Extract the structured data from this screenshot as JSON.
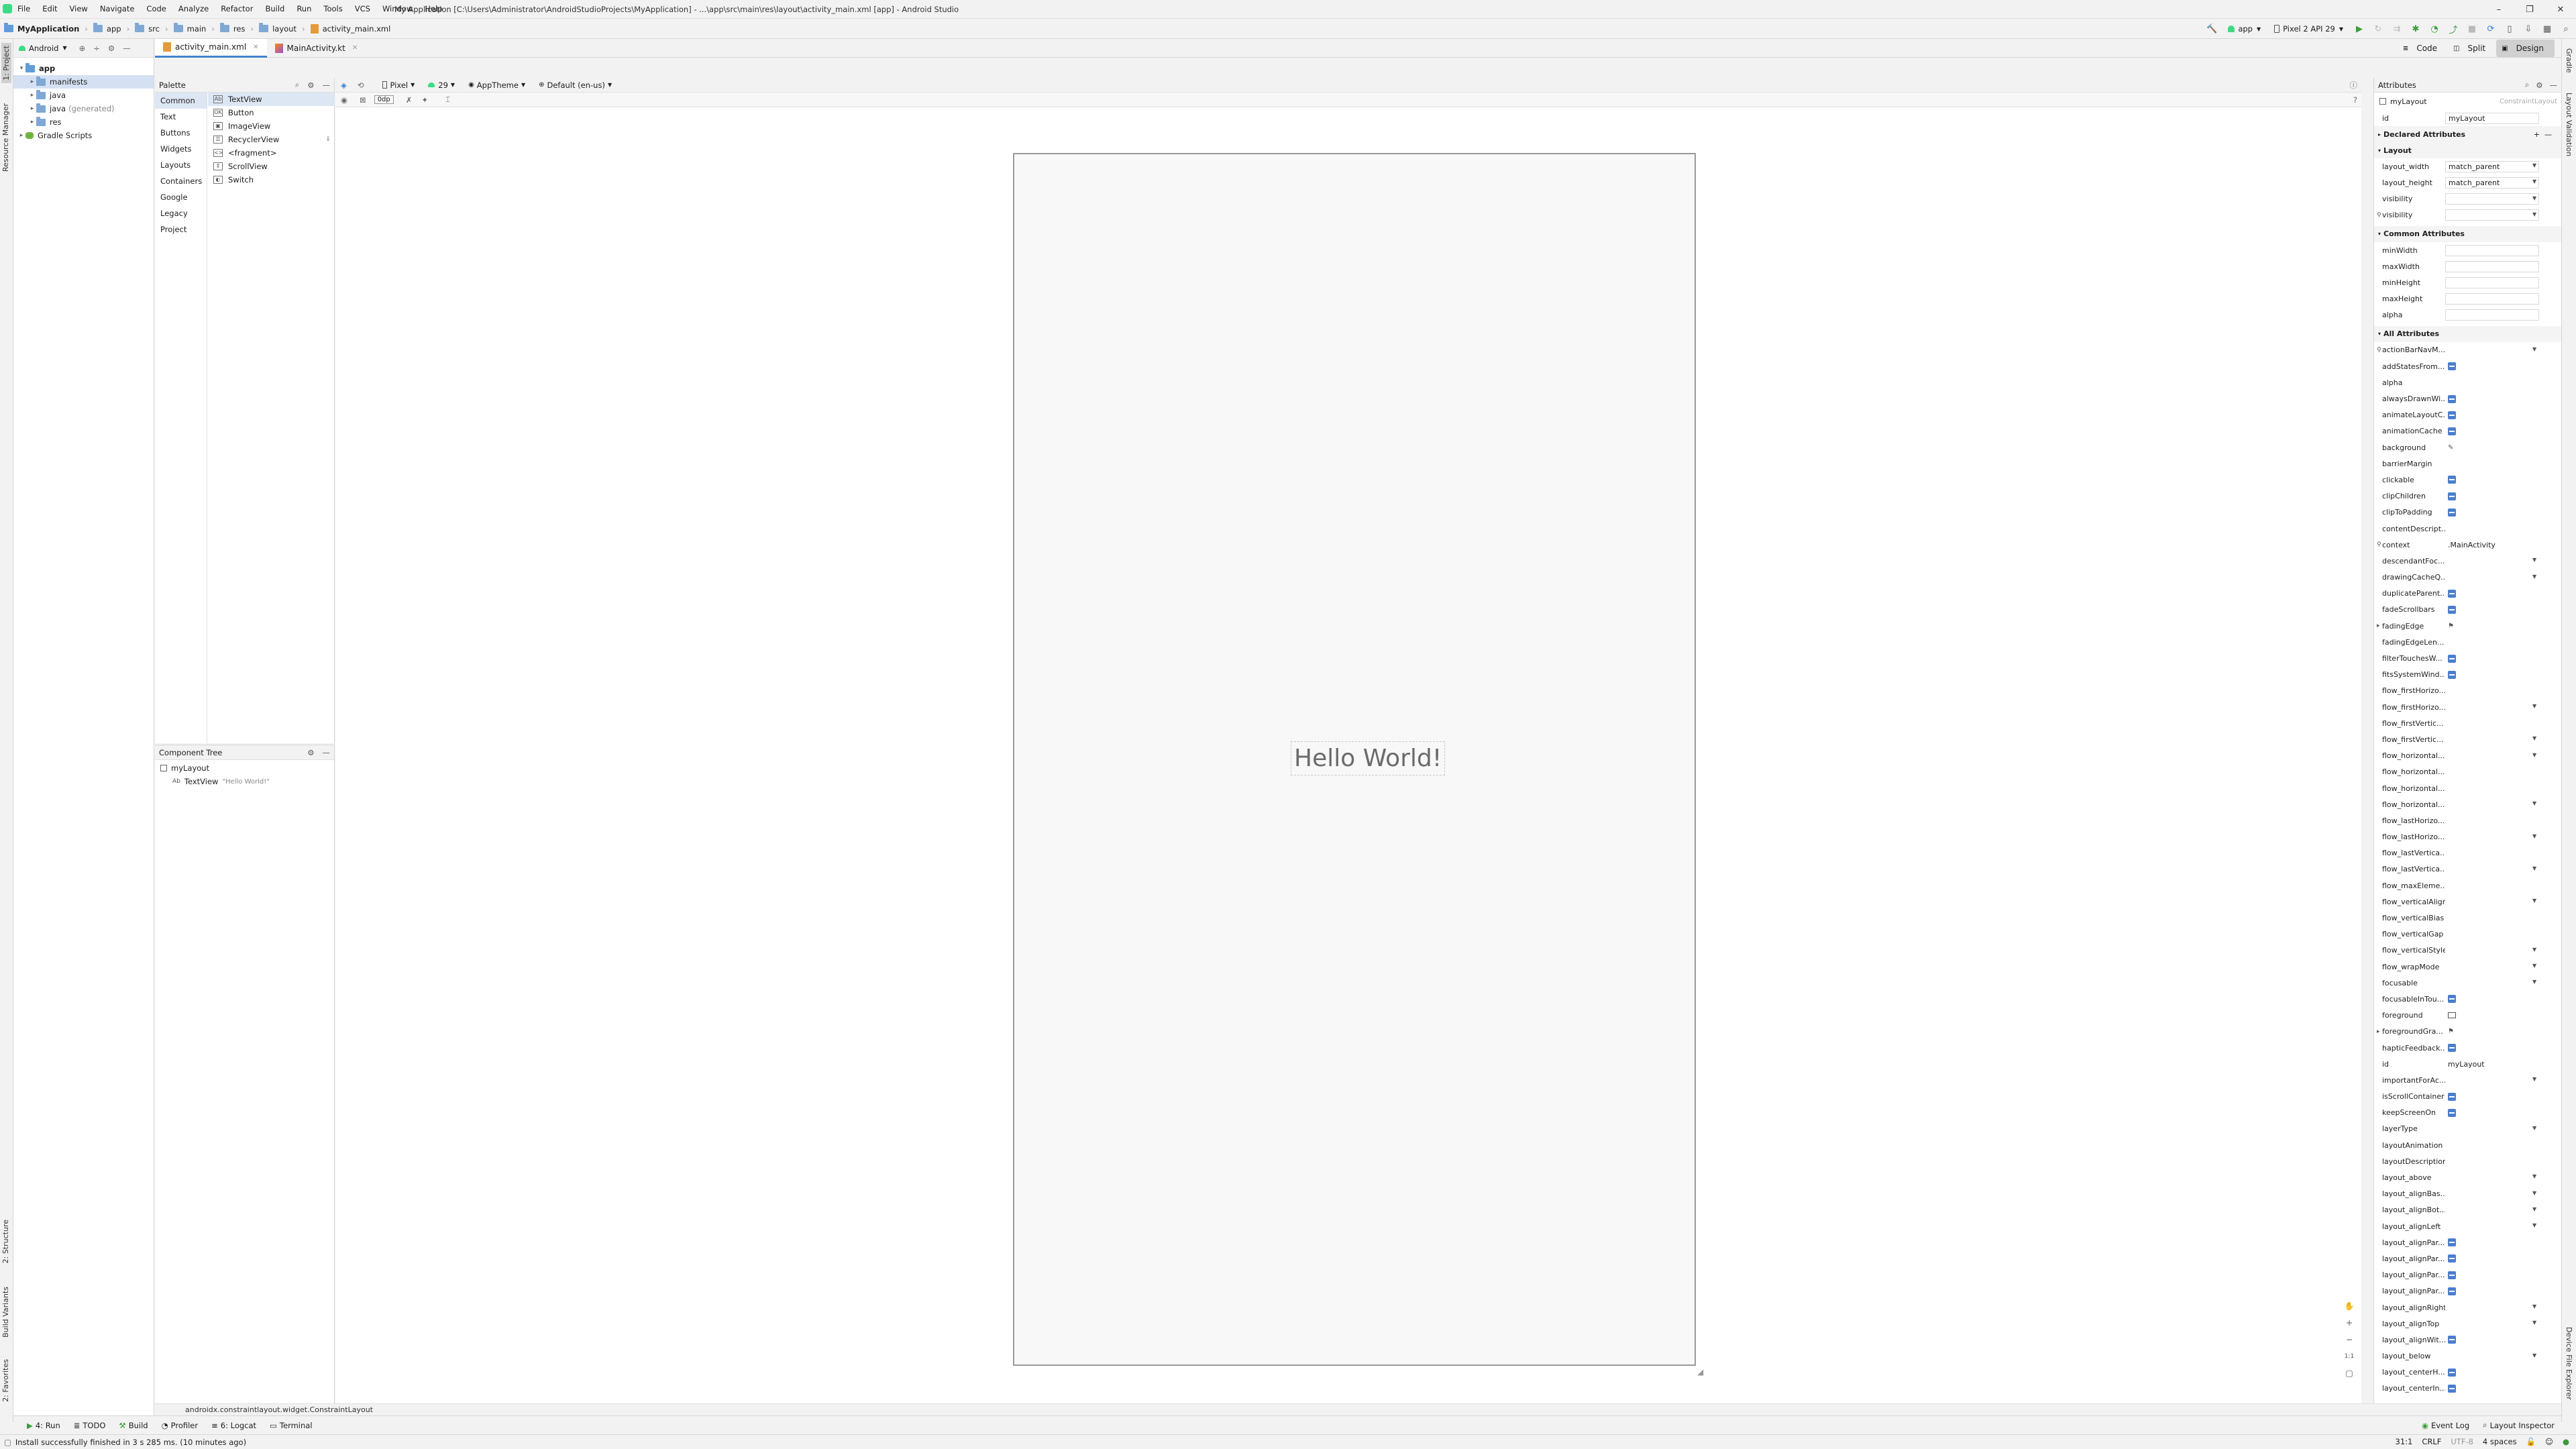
{
  "menu": [
    "File",
    "Edit",
    "View",
    "Navigate",
    "Code",
    "Analyze",
    "Refactor",
    "Build",
    "Run",
    "Tools",
    "VCS",
    "Window",
    "Help"
  ],
  "window_title": "My Application [C:\\Users\\Administrator\\AndroidStudioProjects\\MyApplication] - ...\\app\\src\\main\\res\\layout\\activity_main.xml [app] - Android Studio",
  "breadcrumbs": [
    "MyApplication",
    "app",
    "src",
    "main",
    "res",
    "layout",
    "activity_main.xml"
  ],
  "toolbar": {
    "run_config": "app",
    "device": "Pixel 2 API 29"
  },
  "project": {
    "view_mode": "Android",
    "tree": [
      {
        "label": "app",
        "depth": 0,
        "expanded": true
      },
      {
        "label": "manifests",
        "depth": 1,
        "selected": true
      },
      {
        "label": "java",
        "depth": 1
      },
      {
        "label": "java",
        "suffix": "(generated)",
        "depth": 1
      },
      {
        "label": "res",
        "depth": 1
      },
      {
        "label": "Gradle Scripts",
        "depth": 0
      }
    ]
  },
  "left_tabs": [
    "1: Project",
    "Resource Manager",
    "2: Structure",
    "Build Variants",
    "2: Favorites"
  ],
  "right_tabs": [
    "Gradle",
    "Layout Validation",
    "Device File Explorer"
  ],
  "editor_tabs": [
    {
      "label": "activity_main.xml",
      "active": true
    },
    {
      "label": "MainActivity.kt",
      "active": false
    }
  ],
  "view_modes": [
    "Code",
    "Split",
    "Design"
  ],
  "palette": {
    "title": "Palette",
    "categories": [
      "Common",
      "Text",
      "Buttons",
      "Widgets",
      "Layouts",
      "Containers",
      "Google",
      "Legacy",
      "Project"
    ],
    "items": [
      "TextView",
      "Button",
      "ImageView",
      "RecyclerView",
      "<fragment>",
      "ScrollView",
      "Switch"
    ]
  },
  "component_tree": {
    "title": "Component Tree",
    "root": "myLayout",
    "child": "TextView",
    "child_text": "\"Hello World!\""
  },
  "design_toolbar": {
    "device": "Pixel",
    "api": "29",
    "theme": "AppTheme",
    "locale": "Default (en-us)",
    "margin": "0dp"
  },
  "canvas": {
    "hello_text": "Hello World!"
  },
  "attributes": {
    "title": "Attributes",
    "component_id": "myLayout",
    "component_class": "ConstraintLayout",
    "id_label": "id",
    "id_value": "myLayout",
    "declared": "Declared Attributes",
    "layout_section": "Layout",
    "layout_rows": [
      {
        "name": "layout_width",
        "value": "match_parent",
        "dd": true
      },
      {
        "name": "layout_height",
        "value": "match_parent",
        "dd": true
      },
      {
        "name": "visibility",
        "value": "",
        "dd": true
      },
      {
        "name": "visibility",
        "value": "",
        "dd": true,
        "pin": true
      }
    ],
    "common_section": "Common Attributes",
    "common_rows": [
      "minWidth",
      "maxWidth",
      "minHeight",
      "maxHeight",
      "alpha"
    ],
    "all_section": "All Attributes",
    "all_rows": [
      {
        "name": "actionBarNavM...",
        "t": "dd",
        "pin": true
      },
      {
        "name": "addStatesFrom...",
        "t": "cb"
      },
      {
        "name": "alpha",
        "t": ""
      },
      {
        "name": "alwaysDrawnWi...",
        "t": "cb"
      },
      {
        "name": "animateLayoutC...",
        "t": "cb"
      },
      {
        "name": "animationCache",
        "t": "cb"
      },
      {
        "name": "background",
        "t": "pen"
      },
      {
        "name": "barrierMargin",
        "t": ""
      },
      {
        "name": "clickable",
        "t": "cb"
      },
      {
        "name": "clipChildren",
        "t": "cb"
      },
      {
        "name": "clipToPadding",
        "t": "cb"
      },
      {
        "name": "contentDescript...",
        "t": ""
      },
      {
        "name": "context",
        "t": "text",
        "value": ".MainActivity",
        "pin": true
      },
      {
        "name": "descendantFoc...",
        "t": "dd"
      },
      {
        "name": "drawingCacheQ...",
        "t": "dd"
      },
      {
        "name": "duplicateParent...",
        "t": "cb"
      },
      {
        "name": "fadeScrollbars",
        "t": "cb"
      },
      {
        "name": "fadingEdge",
        "t": "flag",
        "expand": true
      },
      {
        "name": "fadingEdgeLen...",
        "t": ""
      },
      {
        "name": "filterTouchesW...",
        "t": "cb"
      },
      {
        "name": "fitsSystemWind...",
        "t": "cb"
      },
      {
        "name": "flow_firstHorizo...",
        "t": ""
      },
      {
        "name": "flow_firstHorizo...",
        "t": "dd"
      },
      {
        "name": "flow_firstVertic...",
        "t": ""
      },
      {
        "name": "flow_firstVertic...",
        "t": "dd"
      },
      {
        "name": "flow_horizontal...",
        "t": "dd"
      },
      {
        "name": "flow_horizontal...",
        "t": ""
      },
      {
        "name": "flow_horizontal...",
        "t": ""
      },
      {
        "name": "flow_horizontal...",
        "t": "dd"
      },
      {
        "name": "flow_lastHorizo...",
        "t": ""
      },
      {
        "name": "flow_lastHorizo...",
        "t": "dd"
      },
      {
        "name": "flow_lastVertica...",
        "t": ""
      },
      {
        "name": "flow_lastVertica...",
        "t": "dd"
      },
      {
        "name": "flow_maxEleme...",
        "t": ""
      },
      {
        "name": "flow_verticalAlign",
        "t": "dd"
      },
      {
        "name": "flow_verticalBias",
        "t": ""
      },
      {
        "name": "flow_verticalGap",
        "t": ""
      },
      {
        "name": "flow_verticalStyle",
        "t": "dd"
      },
      {
        "name": "flow_wrapMode",
        "t": "dd"
      },
      {
        "name": "focusable",
        "t": "dd"
      },
      {
        "name": "focusableInTou...",
        "t": "cb"
      },
      {
        "name": "foreground",
        "t": "img"
      },
      {
        "name": "foregroundGra...",
        "t": "flag",
        "expand": true
      },
      {
        "name": "hapticFeedback...",
        "t": "cb"
      },
      {
        "name": "id",
        "t": "text",
        "value": "myLayout"
      },
      {
        "name": "importantForAc...",
        "t": "dd"
      },
      {
        "name": "isScrollContainer",
        "t": "cb"
      },
      {
        "name": "keepScreenOn",
        "t": "cb"
      },
      {
        "name": "layerType",
        "t": "dd"
      },
      {
        "name": "layoutAnimation",
        "t": ""
      },
      {
        "name": "layoutDescription",
        "t": ""
      },
      {
        "name": "layout_above",
        "t": "dd"
      },
      {
        "name": "layout_alignBas...",
        "t": "dd"
      },
      {
        "name": "layout_alignBot...",
        "t": "dd"
      },
      {
        "name": "layout_alignLeft",
        "t": "dd"
      },
      {
        "name": "layout_alignPar...",
        "t": "cb"
      },
      {
        "name": "layout_alignPar...",
        "t": "cb"
      },
      {
        "name": "layout_alignPar...",
        "t": "cb"
      },
      {
        "name": "layout_alignPar...",
        "t": "cb"
      },
      {
        "name": "layout_alignRight",
        "t": "dd"
      },
      {
        "name": "layout_alignTop",
        "t": "dd"
      },
      {
        "name": "layout_alignWit...",
        "t": "cb"
      },
      {
        "name": "layout_below",
        "t": "dd"
      },
      {
        "name": "layout_centerH...",
        "t": "cb"
      },
      {
        "name": "layout_centerIn...",
        "t": "cb"
      }
    ]
  },
  "status_ref": "androidx.constraintlayout.widget.ConstraintLayout",
  "tool_windows": [
    "4: Run",
    "TODO",
    "Build",
    "Profiler",
    "6: Logcat",
    "Terminal"
  ],
  "tool_windows_right": [
    "Event Log",
    "Layout Inspector"
  ],
  "status": {
    "message": "Install successfully finished in 3 s 285 ms. (10 minutes ago)",
    "pos": "31:1",
    "eol": "CRLF",
    "enc": "UTF-8",
    "indent": "4 spaces"
  }
}
